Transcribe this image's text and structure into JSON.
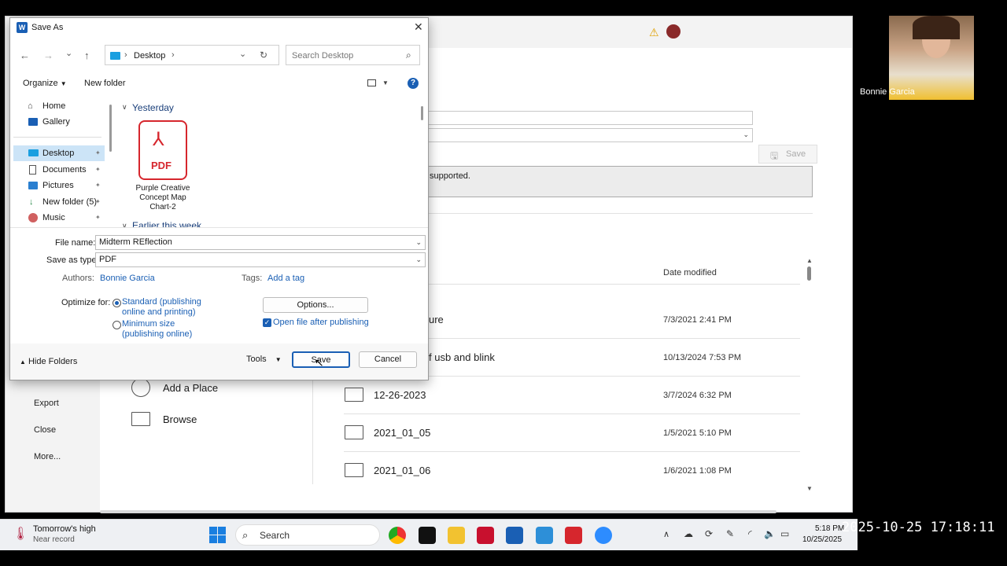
{
  "background_window": {
    "backstage_menu": [
      "Export",
      "Close",
      "More..."
    ],
    "places": [
      "Add a Place",
      "Browse"
    ],
    "save_button": "Save",
    "notice_text": "supported.",
    "list_header_date": "Date modified",
    "rows": [
      {
        "name": "ure",
        "date": "7/3/2021 2:41 PM"
      },
      {
        "name": "f usb and blink",
        "date": "10/13/2024 7:53 PM"
      },
      {
        "name": "12-26-2023",
        "date": "3/7/2024 6:32 PM"
      },
      {
        "name": "2021_01_05",
        "date": "1/5/2021 5:10 PM"
      },
      {
        "name": "2021_01_06",
        "date": "1/6/2021 1:08 PM"
      }
    ]
  },
  "dialog": {
    "title": "Save As",
    "address_path": "Desktop",
    "search_placeholder": "Search Desktop",
    "organize_label": "Organize",
    "new_folder_label": "New folder",
    "nav_items": [
      {
        "label": "Home",
        "icon": "home-icon"
      },
      {
        "label": "Gallery",
        "icon": "gallery-icon"
      },
      {
        "label": "Desktop",
        "icon": "desktop-icon",
        "selected": true
      },
      {
        "label": "Documents",
        "icon": "documents-icon"
      },
      {
        "label": "Pictures",
        "icon": "pictures-icon"
      },
      {
        "label": "New folder (5)",
        "icon": "download-icon"
      },
      {
        "label": "Music",
        "icon": "music-icon"
      }
    ],
    "group_yesterday": "Yesterday",
    "group_earlier": "Earlier this week",
    "file_item": {
      "icon_label": "PDF",
      "name": "Purple Creative Concept Map Chart-2"
    },
    "file_name_label": "File name:",
    "file_name_value": "Midterm REflection",
    "save_type_label": "Save as type:",
    "save_type_value": "PDF",
    "authors_label": "Authors:",
    "authors_value": "Bonnie Garcia",
    "tags_label": "Tags:",
    "tags_value": "Add a tag",
    "optimize_label": "Optimize for:",
    "optimize_standard": "Standard (publishing online and printing)",
    "optimize_minimum": "Minimum size (publishing online)",
    "options_button": "Options...",
    "open_after_label": "Open file after publishing",
    "hide_folders_label": "Hide Folders",
    "tools_label": "Tools",
    "save_button": "Save",
    "cancel_button": "Cancel"
  },
  "webcam": {
    "name": "Bonnie Garcia"
  },
  "taskbar": {
    "weather_title": "Tomorrow's high",
    "weather_sub": "Near record",
    "search_label": "Search",
    "clock_time": "5:18 PM",
    "clock_date": "10/25/2025"
  },
  "overlay_timestamp": "2025-10-25 17:18:11",
  "colors": {
    "accent": "#1a5fb4",
    "pdf_red": "#d6262d",
    "selected": "#cce4f7"
  }
}
